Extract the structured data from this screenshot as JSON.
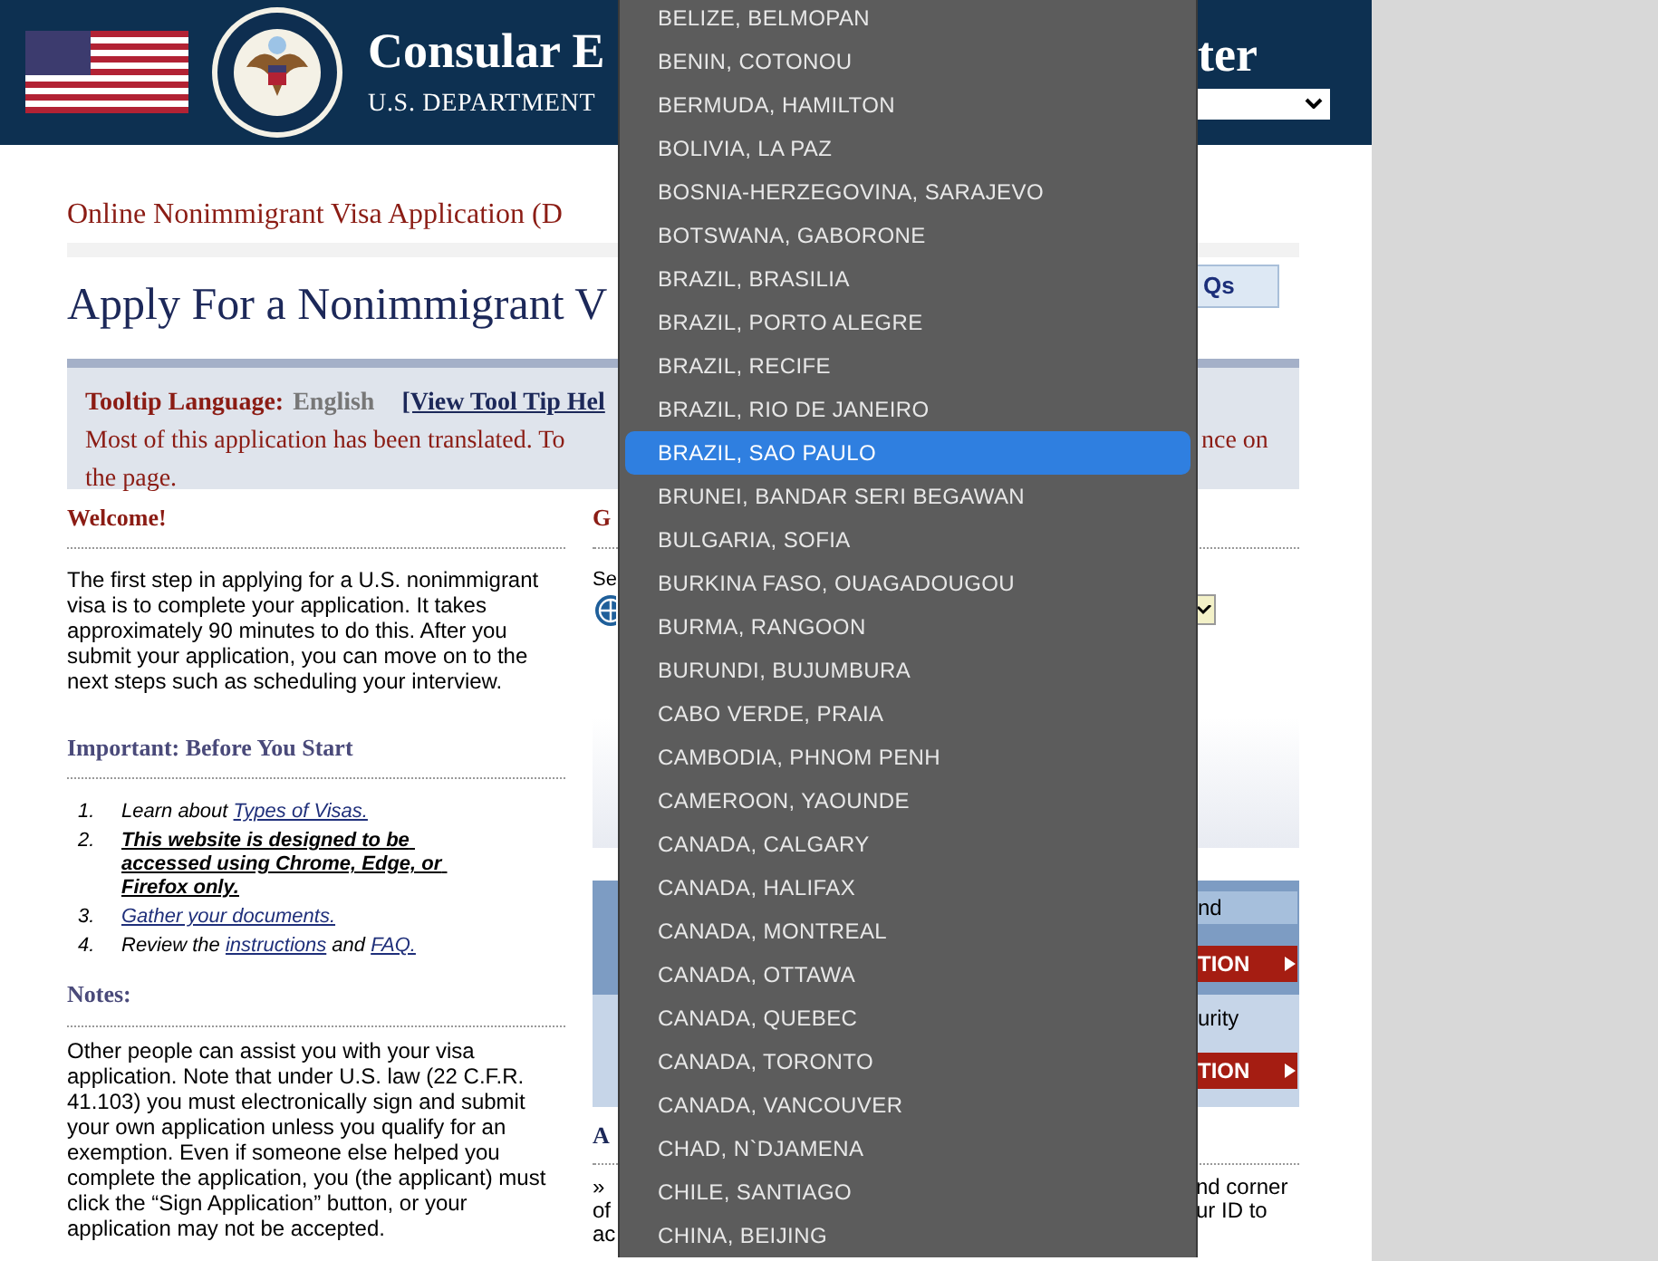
{
  "header": {
    "title": "Consular E",
    "title_tail": "ter",
    "subtitle": "U.S. DEPARTMENT"
  },
  "page": {
    "breadcrumb": "Online Nonimmigrant Visa Application (D",
    "heading": "Apply For a Nonimmigrant V",
    "faq_button": "Qs"
  },
  "tooltip_bar": {
    "label": "Tooltip Language:",
    "value": "English",
    "link": "[View Tool Tip Hel",
    "notice": "Most of this application has been translated. To",
    "notice_tail": "nce on",
    "notice_line2": "the page."
  },
  "welcome": {
    "heading": "Welcome!",
    "text": "The first step in applying for a U.S. nonimmigrant visa is to complete your application. It takes approximately 90 minutes to do this. After you submit your application, you can move on to the next steps such as scheduling your interview."
  },
  "important": {
    "heading": "Important: Before You Start",
    "items": [
      {
        "number": "1.",
        "parts": [
          {
            "kind": "plain",
            "text": "Learn about "
          },
          {
            "kind": "link",
            "text": "Types of Visas."
          }
        ]
      },
      {
        "number": "2.",
        "parts": [
          {
            "kind": "strong",
            "text": "This website is designed to be accessed using Chrome, Edge, or Firefox only."
          }
        ]
      },
      {
        "number": "3.",
        "parts": [
          {
            "kind": "link",
            "text": "Gather your documents."
          }
        ]
      },
      {
        "number": "4.",
        "parts": [
          {
            "kind": "plain",
            "text": "Review the "
          },
          {
            "kind": "link",
            "text": "instructions"
          },
          {
            "kind": "plain",
            "text": " and "
          },
          {
            "kind": "link",
            "text": "FAQ."
          }
        ]
      }
    ]
  },
  "notes": {
    "heading": "Notes:",
    "text": "Other people can assist you with your visa application. Note that under U.S. law (22 C.F.R. 41.103) you must electronically sign and submit your own application unless you qualify for an exemption. Even if someone else helped you complete the application, you (the applicant) must click the “Sign Application” button, or your application may not be accepted."
  },
  "right_column": {
    "heading_start": "G",
    "label_start": "Se",
    "panel_text_1": "nd",
    "panel_button_1": "TION",
    "panel_text_2": "urity",
    "panel_button_2": "TION",
    "section_heading_start": "A",
    "lines_start": [
      "»",
      "of",
      "ac"
    ],
    "lines_end": [
      "nd corner",
      "ur ID to"
    ]
  },
  "menu": {
    "options": [
      {
        "label": "BELIZE, BELMOPAN",
        "selected": false
      },
      {
        "label": "BENIN, COTONOU",
        "selected": false
      },
      {
        "label": "BERMUDA, HAMILTON",
        "selected": false
      },
      {
        "label": "BOLIVIA, LA PAZ",
        "selected": false
      },
      {
        "label": "BOSNIA-HERZEGOVINA, SARAJEVO",
        "selected": false
      },
      {
        "label": "BOTSWANA, GABORONE",
        "selected": false
      },
      {
        "label": "BRAZIL, BRASILIA",
        "selected": false
      },
      {
        "label": "BRAZIL, PORTO ALEGRE",
        "selected": false
      },
      {
        "label": "BRAZIL, RECIFE",
        "selected": false
      },
      {
        "label": "BRAZIL, RIO DE JANEIRO",
        "selected": false
      },
      {
        "label": "BRAZIL, SAO PAULO",
        "selected": true
      },
      {
        "label": "BRUNEI, BANDAR SERI BEGAWAN",
        "selected": false
      },
      {
        "label": "BULGARIA, SOFIA",
        "selected": false
      },
      {
        "label": "BURKINA FASO, OUAGADOUGOU",
        "selected": false
      },
      {
        "label": "BURMA, RANGOON",
        "selected": false
      },
      {
        "label": "BURUNDI, BUJUMBURA",
        "selected": false
      },
      {
        "label": "CABO VERDE, PRAIA",
        "selected": false
      },
      {
        "label": "CAMBODIA, PHNOM PENH",
        "selected": false
      },
      {
        "label": "CAMEROON, YAOUNDE",
        "selected": false
      },
      {
        "label": "CANADA, CALGARY",
        "selected": false
      },
      {
        "label": "CANADA, HALIFAX",
        "selected": false
      },
      {
        "label": "CANADA, MONTREAL",
        "selected": false
      },
      {
        "label": "CANADA, OTTAWA",
        "selected": false
      },
      {
        "label": "CANADA, QUEBEC",
        "selected": false
      },
      {
        "label": "CANADA, TORONTO",
        "selected": false
      },
      {
        "label": "CANADA, VANCOUVER",
        "selected": false
      },
      {
        "label": "CHAD, N`DJAMENA",
        "selected": false
      },
      {
        "label": "CHILE, SANTIAGO",
        "selected": false
      },
      {
        "label": "CHINA, BEIJING",
        "selected": false
      }
    ]
  }
}
